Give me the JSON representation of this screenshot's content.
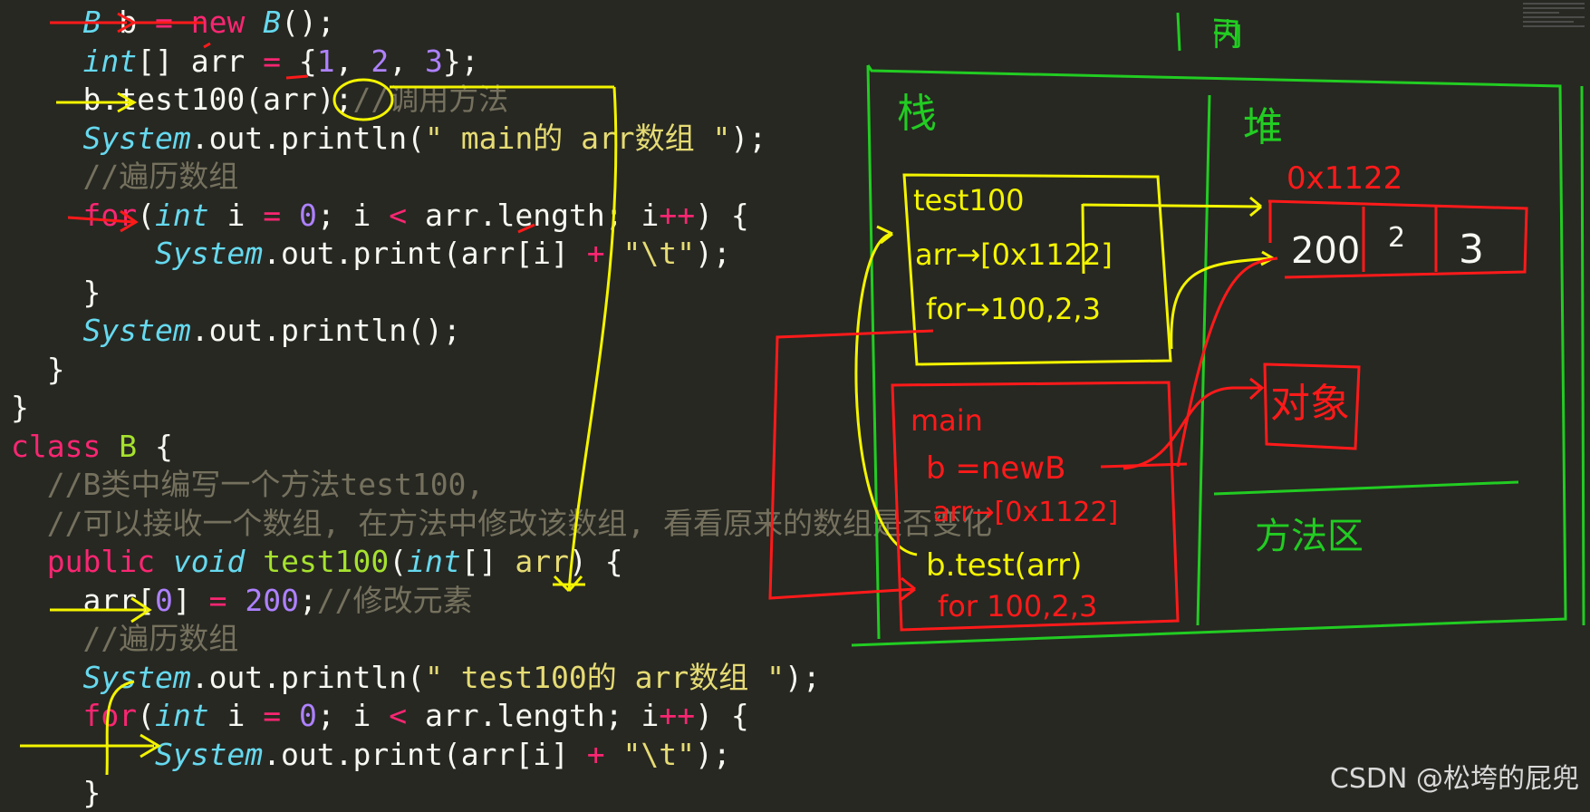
{
  "editor": {
    "lines": [
      [
        {
          "t": "    "
        },
        {
          "t": "B",
          "c": "ty"
        },
        {
          "t": " b "
        },
        {
          "t": "=",
          "c": "kw"
        },
        {
          "t": " "
        },
        {
          "t": "new",
          "c": "kw"
        },
        {
          "t": " "
        },
        {
          "t": "B",
          "c": "ty"
        },
        {
          "t": "();"
        }
      ],
      [
        {
          "t": "    "
        },
        {
          "t": "int",
          "c": "ty"
        },
        {
          "t": "[] arr "
        },
        {
          "t": "=",
          "c": "kw"
        },
        {
          "t": " {"
        },
        {
          "t": "1",
          "c": "num"
        },
        {
          "t": ", "
        },
        {
          "t": "2",
          "c": "num"
        },
        {
          "t": ", "
        },
        {
          "t": "3",
          "c": "num"
        },
        {
          "t": "};"
        }
      ],
      [
        {
          "t": "    b.test100(arr);"
        },
        {
          "t": "//调用方法",
          "c": "cm"
        }
      ],
      [
        {
          "t": "    "
        },
        {
          "t": "System",
          "c": "ty"
        },
        {
          "t": "."
        },
        {
          "t": "out",
          "c": "pl"
        },
        {
          "t": ".println("
        },
        {
          "t": "\" main的 arr数组 \"",
          "c": "str"
        },
        {
          "t": ");"
        }
      ],
      [
        {
          "t": "    "
        },
        {
          "t": "//遍历数组",
          "c": "cm"
        }
      ],
      [
        {
          "t": "    "
        },
        {
          "t": "for",
          "c": "kw"
        },
        {
          "t": "("
        },
        {
          "t": "int",
          "c": "ty"
        },
        {
          "t": " i "
        },
        {
          "t": "=",
          "c": "kw"
        },
        {
          "t": " "
        },
        {
          "t": "0",
          "c": "num"
        },
        {
          "t": "; i "
        },
        {
          "t": "<",
          "c": "kw"
        },
        {
          "t": " arr.length; i"
        },
        {
          "t": "++",
          "c": "kw"
        },
        {
          "t": ") {"
        }
      ],
      [
        {
          "t": "        "
        },
        {
          "t": "System",
          "c": "ty"
        },
        {
          "t": ".out.print(arr[i] "
        },
        {
          "t": "+",
          "c": "kw"
        },
        {
          "t": " "
        },
        {
          "t": "\"\\t\"",
          "c": "str"
        },
        {
          "t": ");"
        }
      ],
      [
        {
          "t": "    }"
        }
      ],
      [
        {
          "t": "    "
        },
        {
          "t": "System",
          "c": "ty"
        },
        {
          "t": ".out.println();"
        }
      ],
      [
        {
          "t": "  }"
        }
      ],
      [
        {
          "t": "}"
        }
      ],
      [
        {
          "t": "class",
          "c": "kw"
        },
        {
          "t": " "
        },
        {
          "t": "B",
          "c": "cls"
        },
        {
          "t": " {"
        }
      ],
      [
        {
          "t": "  "
        },
        {
          "t": "//B类中编写一个方法test100,",
          "c": "cm"
        }
      ],
      [
        {
          "t": "  "
        },
        {
          "t": "//可以接收一个数组, 在方法中修改该数组, 看看原来的数组是否变化",
          "c": "cm"
        }
      ],
      [
        {
          "t": "  "
        },
        {
          "t": "public",
          "c": "kw"
        },
        {
          "t": " "
        },
        {
          "t": "void",
          "c": "ty"
        },
        {
          "t": " "
        },
        {
          "t": "test100",
          "c": "fn"
        },
        {
          "t": "("
        },
        {
          "t": "int",
          "c": "ty"
        },
        {
          "t": "[] "
        },
        {
          "t": "arr",
          "c": "str"
        },
        {
          "t": ") {"
        }
      ],
      [
        {
          "t": "    arr["
        },
        {
          "t": "0",
          "c": "num"
        },
        {
          "t": "] "
        },
        {
          "t": "=",
          "c": "kw"
        },
        {
          "t": " "
        },
        {
          "t": "200",
          "c": "num"
        },
        {
          "t": ";"
        },
        {
          "t": "//修改元素",
          "c": "cm"
        }
      ],
      [
        {
          "t": "    "
        },
        {
          "t": "//遍历数组",
          "c": "cm"
        }
      ],
      [
        {
          "t": "    "
        },
        {
          "t": "System",
          "c": "ty"
        },
        {
          "t": ".out.println("
        },
        {
          "t": "\" test100的 arr数组 \"",
          "c": "str"
        },
        {
          "t": ");"
        }
      ],
      [
        {
          "t": "    "
        },
        {
          "t": "for",
          "c": "kw"
        },
        {
          "t": "("
        },
        {
          "t": "int",
          "c": "ty"
        },
        {
          "t": " i "
        },
        {
          "t": "=",
          "c": "kw"
        },
        {
          "t": " "
        },
        {
          "t": "0",
          "c": "num"
        },
        {
          "t": "; i "
        },
        {
          "t": "<",
          "c": "kw"
        },
        {
          "t": " arr.length; i"
        },
        {
          "t": "++",
          "c": "kw"
        },
        {
          "t": ") {"
        }
      ],
      [
        {
          "t": "        "
        },
        {
          "t": "System",
          "c": "ty"
        },
        {
          "t": ".out.print(arr[i] "
        },
        {
          "t": "+",
          "c": "kw"
        },
        {
          "t": " "
        },
        {
          "t": "\"\\t\"",
          "c": "str"
        },
        {
          "t": ");"
        }
      ],
      [
        {
          "t": "    }"
        }
      ]
    ]
  },
  "annotations": {
    "label_top": "内",
    "label_stack": "栈",
    "label_heap": "堆",
    "heap_address": "0x1122",
    "heap_values": [
      "200",
      "2",
      "3"
    ],
    "frame_test100": "test100",
    "frame_test100_arr": "arr→[0x1122]",
    "frame_test100_for": "for→100,2,3",
    "frame_main": "main",
    "frame_main_b": "b =newB",
    "frame_main_arr": "arr→[0x1122]",
    "frame_main_call": "b.test(arr)",
    "frame_main_for": "for 100,2,3",
    "label_object": "对象",
    "label_method_area": "方法区"
  },
  "colors": {
    "background": "#272822",
    "ink_green": "#22cc22",
    "ink_yellow": "#f4f400",
    "ink_red": "#ff1a1a"
  },
  "watermark": "CSDN @松垮的屁兜"
}
